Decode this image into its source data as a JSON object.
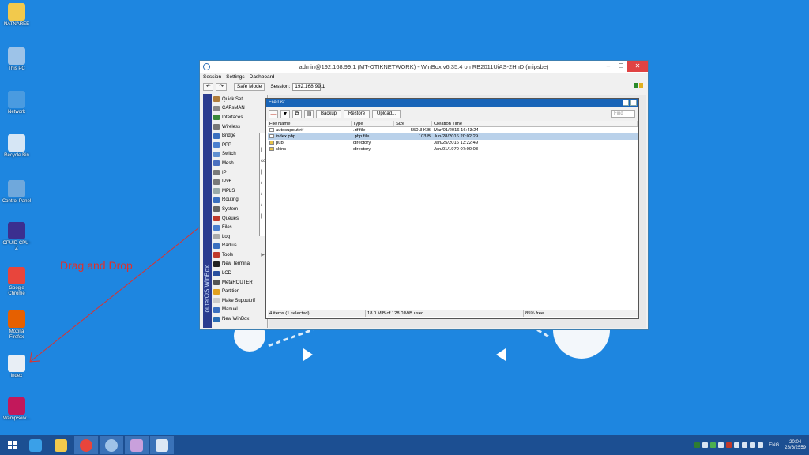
{
  "desktop": {
    "icons": [
      {
        "label": "NATNAREE",
        "icon": "folder-icon",
        "color": "#f2c94c"
      },
      {
        "label": "This PC",
        "icon": "computer-icon",
        "color": "#9dc3e8"
      },
      {
        "label": "Network",
        "icon": "network-icon",
        "color": "#4a9be0"
      },
      {
        "label": "Recycle Bin",
        "icon": "recycle-bin-icon",
        "color": "#d6e6f5"
      },
      {
        "label": "Control Panel",
        "icon": "control-panel-icon",
        "color": "#6fa8dc"
      },
      {
        "label": "CPUID CPU-Z",
        "icon": "cpu-z-icon",
        "color": "#3b2f8f"
      },
      {
        "label": "Google Chrome",
        "icon": "chrome-icon",
        "color": "#e8453c"
      },
      {
        "label": "Mozilla Firefox",
        "icon": "firefox-icon",
        "color": "#e66000"
      },
      {
        "label": "index",
        "icon": "php-file-icon",
        "color": "#e8eef5"
      },
      {
        "label": "WampServ...",
        "icon": "wampserver-icon",
        "color": "#c2185b"
      }
    ]
  },
  "annotation": {
    "text": "Drag and Drop",
    "color": "#e0302a"
  },
  "window": {
    "title": "admin@192.168.99.1 (MT-OTIKNETWORK) - WinBox v6.35.4 on RB2011UiAS-2HnD (mipsbe)",
    "min": "–",
    "max": "☐",
    "close": "✕",
    "menu": [
      "Session",
      "Settings",
      "Dashboard"
    ],
    "toolbar": {
      "undo": "↶",
      "redo": "↷",
      "safe_mode": "Safe Mode",
      "session_label": "Session:",
      "session_value": "192.168.99.1"
    },
    "brand_vertical": "outerOS WinBox",
    "side_menu": [
      {
        "label": "Quick Set",
        "icon": "quick-set-icon",
        "color": "#b07d3c",
        "sub": false
      },
      {
        "label": "CAPsMAN",
        "icon": "capsman-icon",
        "color": "#888",
        "sub": false
      },
      {
        "label": "Interfaces",
        "icon": "interfaces-icon",
        "color": "#3a8a3a",
        "sub": false
      },
      {
        "label": "Wireless",
        "icon": "wireless-icon",
        "color": "#777",
        "sub": false
      },
      {
        "label": "Bridge",
        "icon": "bridge-icon",
        "color": "#3a6fc0",
        "sub": false
      },
      {
        "label": "PPP",
        "icon": "ppp-icon",
        "color": "#4a7fcf",
        "sub": false
      },
      {
        "label": "Switch",
        "icon": "switch-icon",
        "color": "#5f8fd0",
        "sub": false
      },
      {
        "label": "Mesh",
        "icon": "mesh-icon",
        "color": "#4a6fc0",
        "sub": false
      },
      {
        "label": "IP",
        "icon": "ip-icon",
        "color": "#7a7a7a",
        "sub": true
      },
      {
        "label": "IPv6",
        "icon": "ipv6-icon",
        "color": "#7a7a7a",
        "sub": true
      },
      {
        "label": "MPLS",
        "icon": "mpls-icon",
        "color": "#9aa",
        "sub": true
      },
      {
        "label": "Routing",
        "icon": "routing-icon",
        "color": "#3a6fc0",
        "sub": true
      },
      {
        "label": "System",
        "icon": "system-icon",
        "color": "#666",
        "sub": true
      },
      {
        "label": "Queues",
        "icon": "queues-icon",
        "color": "#c0392b",
        "sub": false
      },
      {
        "label": "Files",
        "icon": "files-icon",
        "color": "#4a7fcf",
        "sub": false
      },
      {
        "label": "Log",
        "icon": "log-icon",
        "color": "#aaa",
        "sub": false
      },
      {
        "label": "Radius",
        "icon": "radius-icon",
        "color": "#3a6fc0",
        "sub": false
      },
      {
        "label": "Tools",
        "icon": "tools-icon",
        "color": "#c0392b",
        "sub": true
      },
      {
        "label": "New Terminal",
        "icon": "terminal-icon",
        "color": "#222",
        "sub": false
      },
      {
        "label": "LCD",
        "icon": "lcd-icon",
        "color": "#2a4f9f",
        "sub": false
      },
      {
        "label": "MetaROUTER",
        "icon": "metarouter-icon",
        "color": "#555",
        "sub": false
      },
      {
        "label": "Partition",
        "icon": "partition-icon",
        "color": "#e0a020",
        "sub": false
      },
      {
        "label": "Make Supout.rif",
        "icon": "supout-icon",
        "color": "#ccc",
        "sub": false
      },
      {
        "label": "Manual",
        "icon": "manual-icon",
        "color": "#3a6fc0",
        "sub": false
      },
      {
        "label": "New WinBox",
        "icon": "winbox-icon",
        "color": "#2a6db5",
        "sub": false
      }
    ],
    "bg_fragments": [
      "[",
      "co",
      "[",
      "/",
      "/",
      "/",
      "["
    ]
  },
  "file_list": {
    "title": "File List",
    "buttons": {
      "remove": "—",
      "filter": "▼",
      "copy": "⧉",
      "paste": "▤",
      "backup": "Backup",
      "restore": "Restore",
      "upload": "Upload..."
    },
    "find_placeholder": "Find",
    "columns": [
      "File Name",
      "Type",
      "Size",
      "Creation Time"
    ],
    "rows": [
      {
        "name": "autosupout.rif",
        "type": ".rif file",
        "size": "550.3 KiB",
        "time": "Mar/01/2016 16:43:24",
        "icon": "file-icon",
        "selected": false
      },
      {
        "name": "index.php",
        "type": ".php file",
        "size": "103 B",
        "time": "Jun/28/2016 20:02:29",
        "icon": "file-icon",
        "selected": true
      },
      {
        "name": "pub",
        "type": "directory",
        "size": "",
        "time": "Jan/25/2016 13:22:49",
        "icon": "folder-icon",
        "selected": false
      },
      {
        "name": "skins",
        "type": "directory",
        "size": "",
        "time": "Jan/01/1970 07:00:03",
        "icon": "folder-icon",
        "selected": false
      }
    ],
    "status": {
      "count": "4 items (1 selected)",
      "usage": "18.0 MiB of 128.0 MiB used",
      "free": "85% free"
    }
  },
  "taskbar": {
    "apps": [
      {
        "name": "internet-explorer",
        "icon": "ie-icon",
        "color": "#3aa0e8"
      },
      {
        "name": "file-explorer",
        "icon": "folder-icon",
        "color": "#f2c94c"
      },
      {
        "name": "chrome",
        "icon": "chrome-icon",
        "color": "#e8453c"
      },
      {
        "name": "winbox",
        "icon": "winbox-icon",
        "color": "#9fc3e8"
      },
      {
        "name": "paint",
        "icon": "paint-icon",
        "color": "#c9a0dc"
      },
      {
        "name": "notepad",
        "icon": "notepad-icon",
        "color": "#dde8f5"
      }
    ],
    "lang": "ENG",
    "time": "20:04",
    "date": "28/6/2559"
  }
}
